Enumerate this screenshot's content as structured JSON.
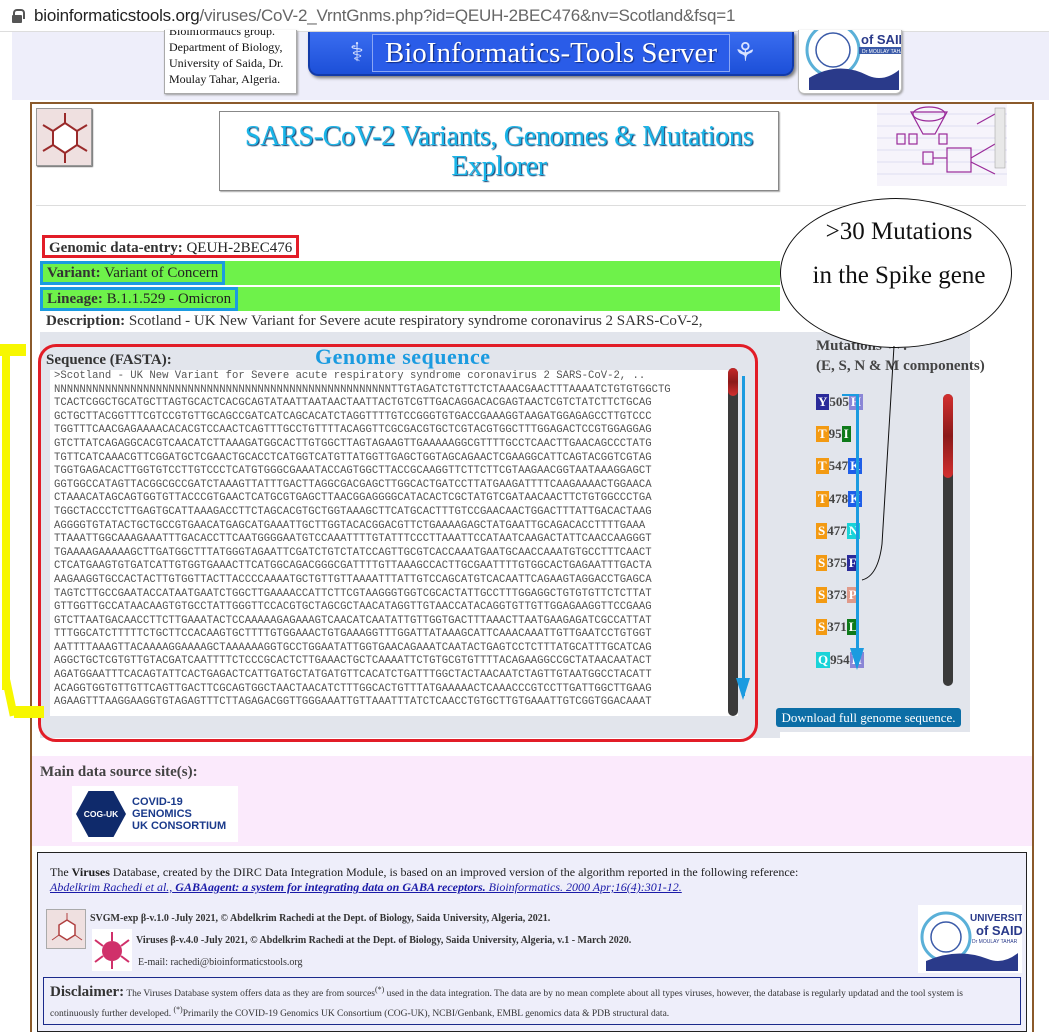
{
  "browser": {
    "url_host": "bioinformaticstools.org",
    "url_path": "/viruses/CoV-2_VrntGnms.php?id=QEUH-2BEC476&nv=Scotland&fsq=1"
  },
  "banner": {
    "dept_lines": [
      "Bioinformatics group.",
      "Department of Biology,",
      "University of Saida, Dr.",
      "Moulay Tahar, Algeria."
    ],
    "server_title": "BioInformatics-Tools Server",
    "univ_logo_text": "of SAIDA",
    "univ_logo_sub": "Dr MOULAY TAHAR"
  },
  "header": {
    "title_line1": "SARS-CoV-2 Variants, Genomes & Mutations",
    "title_line2": "Explorer"
  },
  "entry": {
    "genomic_label": "Genomic data-entry:",
    "genomic_value": "QEUH-2BEC476",
    "variant_label": "Variant:",
    "variant_value": "Variant of Concern",
    "lineage_label": "Lineage:",
    "lineage_value": "B.1.1.529 - Omicron",
    "description_label": "Description:",
    "description_value": "Scotland - UK New Variant for Severe acute respiratory syndrome coronavirus 2 SARS-CoV-2,"
  },
  "annotation": {
    "callout_line1": ">30 Mutations",
    "callout_line2": "in the Spike gene",
    "genome_label": "Genome sequence"
  },
  "sequence": {
    "label": "Sequence (FASTA):",
    "lines": [
      ">Scotland - UK New Variant for Severe acute respiratory syndrome coronavirus 2 SARS-CoV-2, ..",
      "NNNNNNNNNNNNNNNNNNNNNNNNNNNNNNNNNNNNNNNNNNNNNNNNNNNNNTTGTAGATCTGTTCTCTAAACGAACTTTAAAATCTGTGTGGCTG",
      "TCACTCGGCTGCATGCTTAGTGCACTCACGCAGTATAATTAATAACTAATTACTGTCGTTGACAGGACACGAGTAACTCGTCTATCTTCTGCAG",
      "GCTGCTTACGGTTTCGTCCGTGTTGCAGCCGATCATCAGCACATCTAGGTTTTGTCCGGGTGTGACCGAAAGGTAAGATGGAGAGCCTTGTCCC",
      "TGGTTTCAACGAGAAAACACACGTCCAACTCAGTTTGCCTGTTTTACAGGTTCGCGACGTGCTCGTACGTGGCTTTGGAGACTCCGTGGAGGAG",
      "GTCTTATCAGAGGCACGTCAACATCTTAAAGATGGCACTTGTGGCTTAGTAGAAGTTGAAAAAGGCGTTTTGCCTCAACTTGAACAGCCCTATG",
      "TGTTCATCAAACGTTCGGATGCTCGAACTGCACCTCATGGTCATGTTATGGTTGAGCTGGTAGCAGAACTCGAAGGCATTCAGTACGGTCGTAG",
      "TGGTGAGACACTTGGTGTCCTTGTCCCTCATGTGGGCGAAATACCAGTGGCTTACCGCAAGGTTCTTCTTCGTAAGAACGGTAATAAAGGAGCT",
      "GGTGGCCATAGTTACGGCGCCGATCTAAAGTTATTTGACTTAGGCGACGAGCTTGGCACTGATCCTTATGAAGATTTTCAAGAAAACTGGAACA",
      "CTAAACATAGCAGTGGTGTTACCCGTGAACTCATGCGTGAGCTTAACGGAGGGGCATACACTCGCTATGTCGATAACAACTTCTGTGGCCCTGA",
      "TGGCTACCCTCTTGAGTGCATTAAAGACCTTCTAGCACGTGCTGGTAAAGCTTCATGCACTTTGTCCGAACAACTGGACTTTATTGACACTAAG",
      "AGGGGTGTATACTGCTGCCGTGAACATGAGCATGAAATTGCTTGGTACACGGACGTTCTGAAAAGAGCTATGAATTGCAGACACCTTTTGAAA",
      "TTAAATTGGCAAAGAAATTTGACACCTTCAATGGGGAATGTCCAAATTTTGTATTTCCCTTAAATTCCATAATCAAGACTATTCAACCAAGGGT",
      "TGAAAAGAAAAAGCTTGATGGCTTTATGGGTAGAATTCGATCTGTCTATCCAGTTGCGTCACCAAATGAATGCAACCAAATGTGCCTTTCAACT",
      "CTCATGAAGTGTGATCATTGTGGTGAAACTTCATGGCAGACGGGCGATTTTGTTAAAGCCACTTGCGAATTTTGTGGCACTGAGAATTTGACTA",
      "AAGAAGGTGCCACTACTTGTGGTTACTTACCCCAAAATGCTGTTGTTAAAATTTATTGTCCAGCATGTCACAATTCAGAAGTAGGACCTGAGCA",
      "TAGTCTTGCCGAATACCATAATGAATCTGGCTTGAAAACCATTCTTCGTAAGGGTGGTCGCACTATTGCCTTTGGAGGCTGTGTGTTCTCTTAT",
      "GTTGGTTGCCATAACAAGTGTGCCTATTGGGTTCCACGTGCTAGCGCTAACATAGGTTGTAACCATACAGGTGTTGTTGGAGAAGGTTCCGAAG",
      "GTCTTAATGACAACCTTCTTGAAATACTCCAAAAAGAGAAAGTCAACATCAATATTGTTGGTGACTTTAAACTTAATGAAGAGATCGCCATTAT",
      "TTTGGCATCTTTTTCTGCTTCCACAAGTGCTTTTGTGGAAACTGTGAAAGGTTTGGATTATAAAGCATTCAAACAAATTGTTGAATCCTGTGGT",
      "AATTTTAAAGTTACAAAAGGAAAAGCTAAAAAAGGTGCCTGGAATATTGGTGAACAGAAATCAATACTGAGTCCTCTTTATGCATTTGCATCAG",
      "AGGCTGCTCGTGTTGTACGATCAATTTTCTCCCGCACTCTTGAAACTGCTCAAAATTCTGTGCGTGTTTTACAGAAGGCCGCTATAACAATACT",
      "AGATGGAATTTCACAGTATTCACTGAGACTCATTGATGCTATGATGTTCACATCTGATTTGGCTACTAACAATCTAGTTGTAATGGCCTACATT",
      "ACAGGTGGTGTTGTTCAGTTGACTTCGCAGTGGCTAACTAACATCTTTGGCACTGTTTATGAAAAACTCAAACCCGTCCTTGATTGGCTTGAAG",
      "AGAAGTTTAAGGAAGGTGTAGAGTTTCTTAGAGACGGTTGGGAAATTGTTAAATTTATCTCAACCTGTGCTTGTGAAATTGTCGGTGGACAAAT"
    ]
  },
  "mutations": {
    "title_line1": "Mutations ++:",
    "title_line2": "(E, S, N & M components)",
    "items": [
      {
        "from": "Y",
        "pos": "505",
        "to": "H",
        "from_color": "#2a2a9a",
        "to_color": "#8a86d6"
      },
      {
        "from": "T",
        "pos": "95",
        "to": "I",
        "from_color": "#f39a12",
        "to_color": "#0e7a1a"
      },
      {
        "from": "T",
        "pos": "547",
        "to": "K",
        "from_color": "#f39a12",
        "to_color": "#1e5ee8"
      },
      {
        "from": "T",
        "pos": "478",
        "to": "K",
        "from_color": "#f39a12",
        "to_color": "#1e5ee8"
      },
      {
        "from": "S",
        "pos": "477",
        "to": "N",
        "from_color": "#f39a12",
        "to_color": "#1ad3d8"
      },
      {
        "from": "S",
        "pos": "375",
        "to": "F",
        "from_color": "#f39a12",
        "to_color": "#2a2a9a"
      },
      {
        "from": "S",
        "pos": "373",
        "to": "P",
        "from_color": "#f39a12",
        "to_color": "#e09a8a"
      },
      {
        "from": "S",
        "pos": "371",
        "to": "L",
        "from_color": "#f39a12",
        "to_color": "#0e7a1a"
      },
      {
        "from": "Q",
        "pos": "954",
        "to": "H",
        "from_color": "#1ad3d8",
        "to_color": "#8a86d6"
      }
    ],
    "download_label": "Download full genome sequence."
  },
  "sources": {
    "label": "Main data source site(s):",
    "coguk_badge": "COG-UK",
    "coguk_lines": [
      "COVID-19",
      "GENOMICS",
      "UK CONSORTIUM"
    ]
  },
  "footer": {
    "ref_pre": "The ",
    "ref_bold": "Viruses",
    "ref_post": " Database, created by the DIRC Data Integration Module, is based on an improved version of the algorithm reported in the following reference:",
    "ref_authors": "Abdelkrim Rachedi et al.,",
    "ref_title": " GABAagent: a system for integrating data on GABA receptors.",
    "ref_journal": " Bioinformatics. 2000 Apr;16(4):301-12.",
    "credit1": "SVGM-exp β-v.1.0 -July 2021, © Abdelkrim Rachedi at the Dept. of Biology, Saida University, Algeria, 2021.",
    "credit2": "Viruses β-v.4.0 -July 2021, © Abdelkrim Rachedi at the Dept. of Biology, Saida University, Algeria, v.1 - March 2020.",
    "email_label": "E-mail: ",
    "email": "rachedi@bioinformaticstools.org",
    "univ_logo_line1": "UNIVERSITY",
    "univ_logo_line2": "of SAIDA",
    "univ_logo_line3": "Dr MOULAY TAHAR",
    "disclaimer_head": "Disclaimer:",
    "disclaimer_text1": " The Viruses Database system offers data as they are from sources",
    "disclaimer_sup": "(*)",
    "disclaimer_text2": " used in the data integration. The data are by no mean complete about all types viruses, however, the database is regularly updatad and the tool system is continuously further developed. ",
    "disclaimer_text3": "Primarily the COVID-19 Genomics UK Consortium (COG-UK), NCBI/Genbank, EMBL genomics data & PDB structural data."
  }
}
